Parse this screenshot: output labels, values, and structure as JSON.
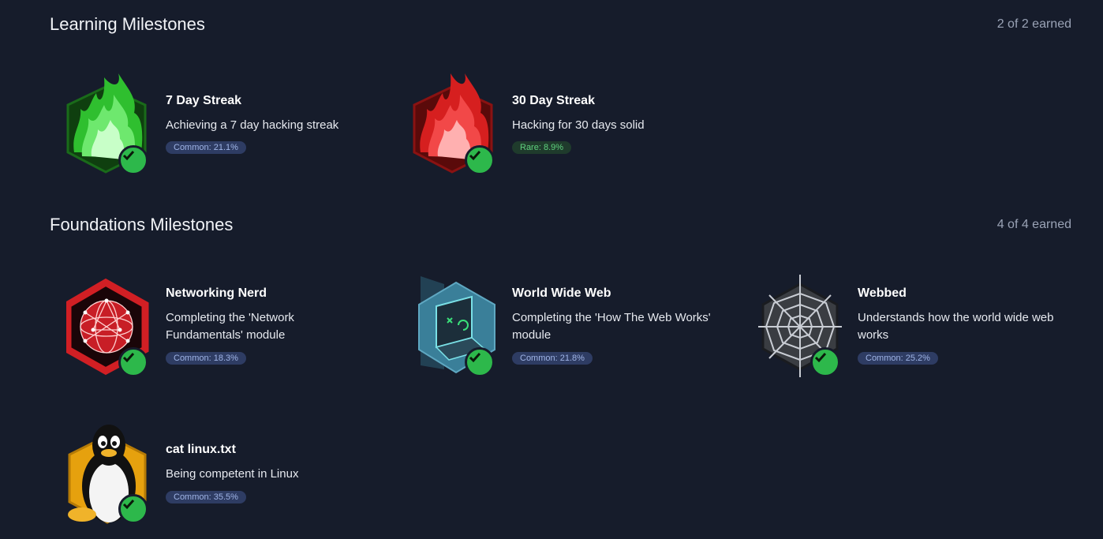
{
  "sections": [
    {
      "title": "Learning Milestones",
      "count": "2 of 2 earned",
      "badges": [
        {
          "name": "7 Day Streak",
          "desc": "Achieving a 7 day hacking streak",
          "rarity": "Common: 21.1%",
          "icon": "green-flame-icon"
        },
        {
          "name": "30 Day Streak",
          "desc": "Hacking for 30 days solid",
          "rarity": "Rare: 8.9%",
          "icon": "red-flame-icon"
        }
      ]
    },
    {
      "title": "Foundations Milestones",
      "count": "4 of 4 earned",
      "badges": [
        {
          "name": "Networking Nerd",
          "desc": "Completing the 'Network Fundamentals' module",
          "rarity": "Common: 18.3%",
          "icon": "network-globe-icon"
        },
        {
          "name": "World Wide Web",
          "desc": "Completing the 'How The Web Works' module",
          "rarity": "Common: 21.8%",
          "icon": "laptop-icon"
        },
        {
          "name": "Webbed",
          "desc": "Understands how the world wide web works",
          "rarity": "Common: 25.2%",
          "icon": "spider-web-icon"
        },
        {
          "name": "cat linux.txt",
          "desc": "Being competent in Linux",
          "rarity": "Common: 35.5%",
          "icon": "linux-penguin-icon"
        }
      ]
    }
  ],
  "colors": {
    "background": "#161c2b",
    "check": "#2db84b",
    "common_pill": "#2e3c63",
    "rare_pill": "#1f3b2c"
  }
}
